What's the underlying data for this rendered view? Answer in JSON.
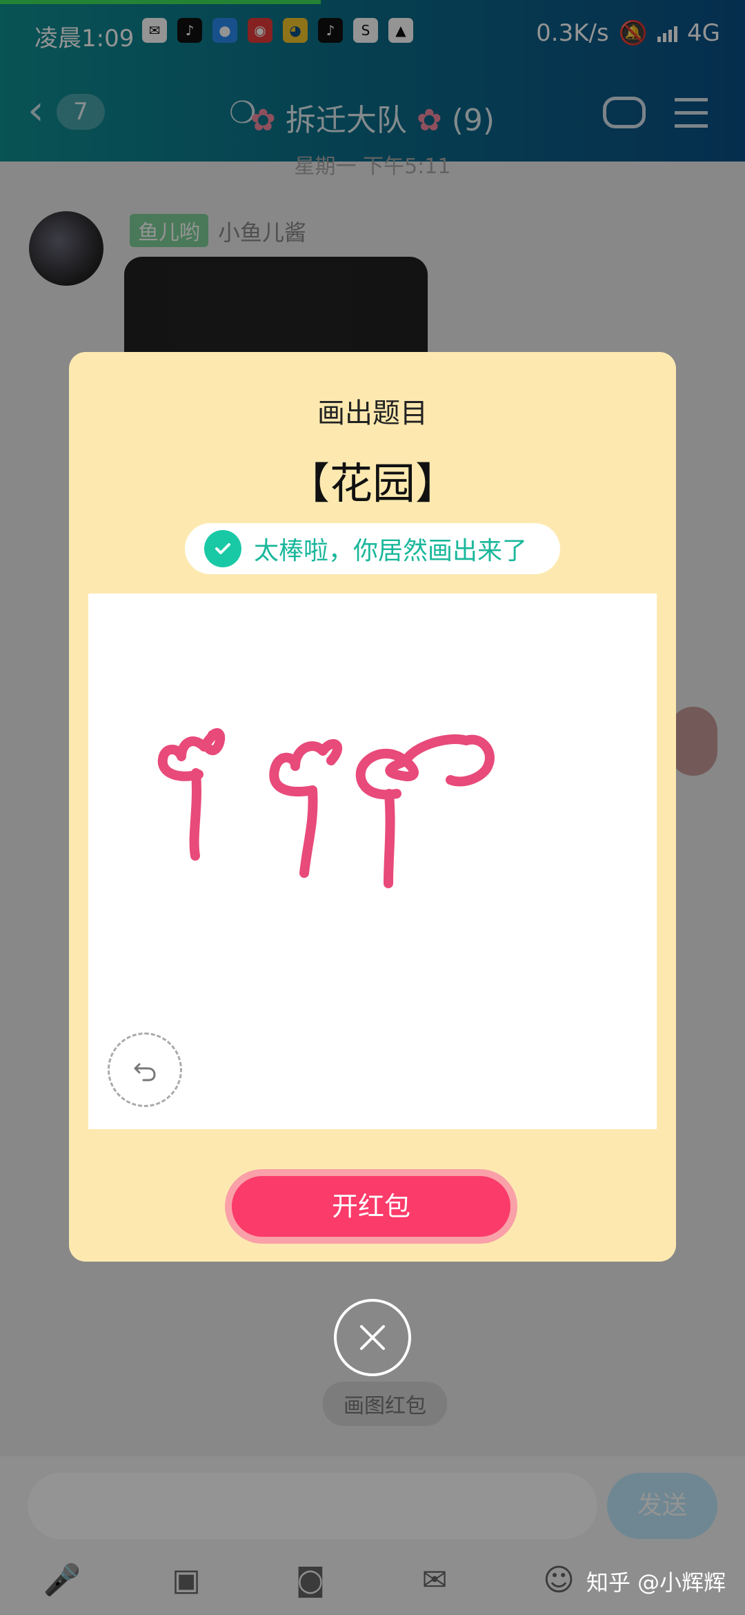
{
  "status_bar": {
    "time": "凌晨1:09",
    "network_speed": "0.3K/s",
    "network_type": "4G",
    "notification_icons": [
      "mail-icon",
      "tiktok-icon",
      "app-icon",
      "news-icon",
      "qq-icon",
      "tiktok-icon",
      "sogou-icon",
      "drive-icon"
    ]
  },
  "navbar": {
    "back_count": "7",
    "title": "拆迁大队",
    "member_count": "(9)"
  },
  "chat": {
    "date_divider": "星期一 下午5:11",
    "messages": [
      {
        "badge": "鱼儿哟",
        "sender": "小鱼儿酱",
        "type": "image"
      }
    ],
    "red_packet_label": "画图红包"
  },
  "input": {
    "placeholder": "",
    "send_label": "发送"
  },
  "modal": {
    "title": "画出题目",
    "topic": "【花园】",
    "success_text": "太棒啦，你居然画出来了",
    "open_button_label": "开红包"
  },
  "watermark": "知乎 @小辉辉",
  "colors": {
    "header_start": "#0e8f92",
    "header_end": "#0a4f86",
    "modal_bg": "#fde9b0",
    "accent_green": "#19c9a5",
    "button_red": "#fb3b6a",
    "stroke_pink": "#e84a7a"
  }
}
